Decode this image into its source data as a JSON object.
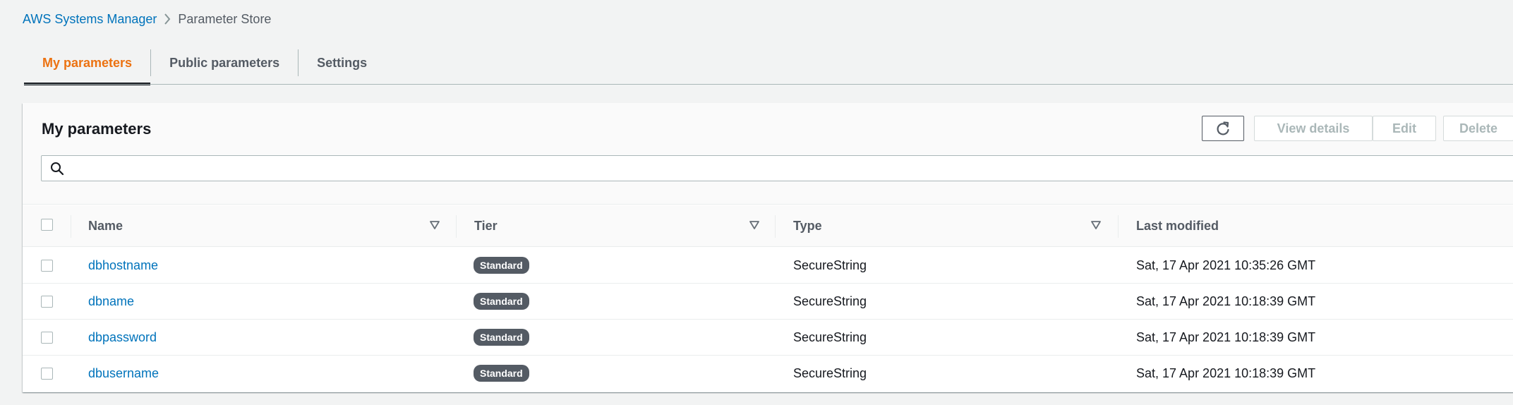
{
  "breadcrumb": {
    "root": "AWS Systems Manager",
    "current": "Parameter Store"
  },
  "tabs": [
    {
      "label": "My parameters",
      "active": true
    },
    {
      "label": "Public parameters",
      "active": false
    },
    {
      "label": "Settings",
      "active": false
    }
  ],
  "panel": {
    "title": "My parameters",
    "buttons": {
      "refresh_icon": "refresh-icon",
      "view_details": "View details",
      "edit": "Edit",
      "delete": "Delete"
    },
    "search": {
      "placeholder": "",
      "value": ""
    }
  },
  "table": {
    "columns": [
      "Name",
      "Tier",
      "Type",
      "Last modified"
    ],
    "rows": [
      {
        "name": "dbhostname",
        "tier": "Standard",
        "type": "SecureString",
        "last_modified": "Sat, 17 Apr 2021 10:35:26 GMT"
      },
      {
        "name": "dbname",
        "tier": "Standard",
        "type": "SecureString",
        "last_modified": "Sat, 17 Apr 2021 10:18:39 GMT"
      },
      {
        "name": "dbpassword",
        "tier": "Standard",
        "type": "SecureString",
        "last_modified": "Sat, 17 Apr 2021 10:18:39 GMT"
      },
      {
        "name": "dbusername",
        "tier": "Standard",
        "type": "SecureString",
        "last_modified": "Sat, 17 Apr 2021 10:18:39 GMT"
      }
    ]
  },
  "colors": {
    "link": "#0073bb",
    "active_tab": "#ec7211",
    "badge_bg": "#545b64"
  }
}
